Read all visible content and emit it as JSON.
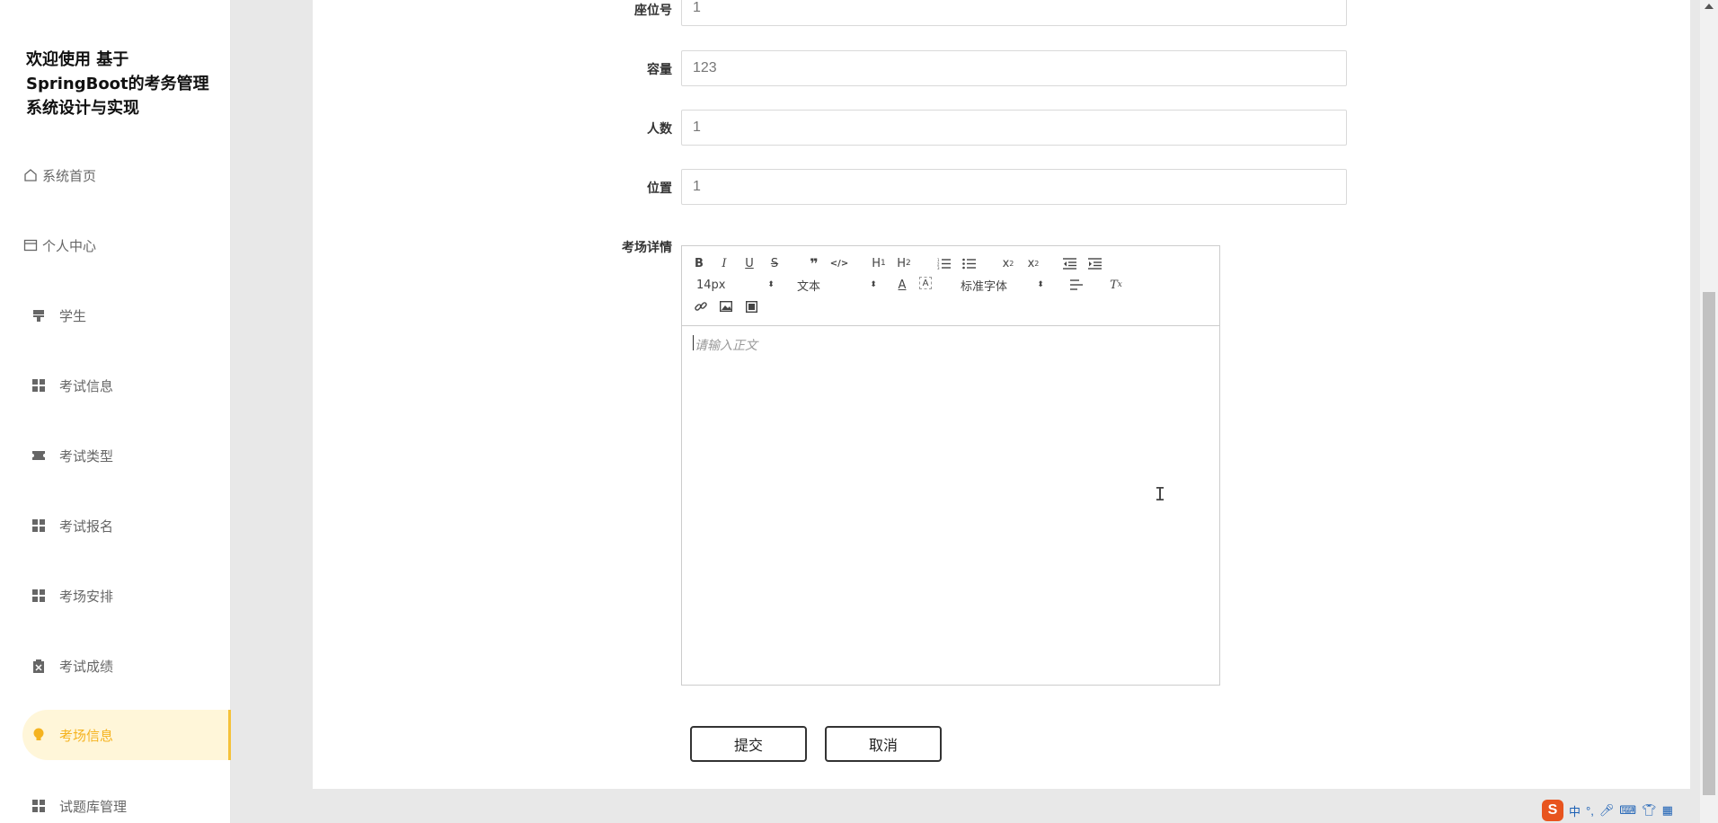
{
  "app_title": "欢迎使用 基于SpringBoot的考务管理系统设计与实现",
  "sidebar": {
    "items": [
      {
        "label": "系统首页",
        "icon": "home-icon"
      },
      {
        "label": "个人中心",
        "icon": "card-icon"
      },
      {
        "label": "学生",
        "icon": "flag-icon"
      },
      {
        "label": "考试信息",
        "icon": "grid-icon"
      },
      {
        "label": "考试类型",
        "icon": "ticket-icon"
      },
      {
        "label": "考试报名",
        "icon": "grid-icon"
      },
      {
        "label": "考场安排",
        "icon": "grid-icon"
      },
      {
        "label": "考试成绩",
        "icon": "clipboard-icon"
      },
      {
        "label": "考场信息",
        "icon": "bulb-icon",
        "active": true
      },
      {
        "label": "试题库管理",
        "icon": "grid-icon"
      }
    ]
  },
  "form": {
    "seat_label": "座位号",
    "seat_value": "1",
    "capacity_label": "容量",
    "capacity_value": "123",
    "people_label": "人数",
    "people_value": "1",
    "location_label": "位置",
    "location_value": "1",
    "detail_label": "考场详情"
  },
  "editor": {
    "font_size": "14px",
    "block_type": "文本",
    "font_family": "标准字体",
    "placeholder": "请输入正文"
  },
  "buttons": {
    "submit": "提交",
    "cancel": "取消"
  },
  "ime": {
    "mode": "中"
  },
  "colors": {
    "accent": "#f5b31f",
    "active_bg": "#fff6d9"
  }
}
